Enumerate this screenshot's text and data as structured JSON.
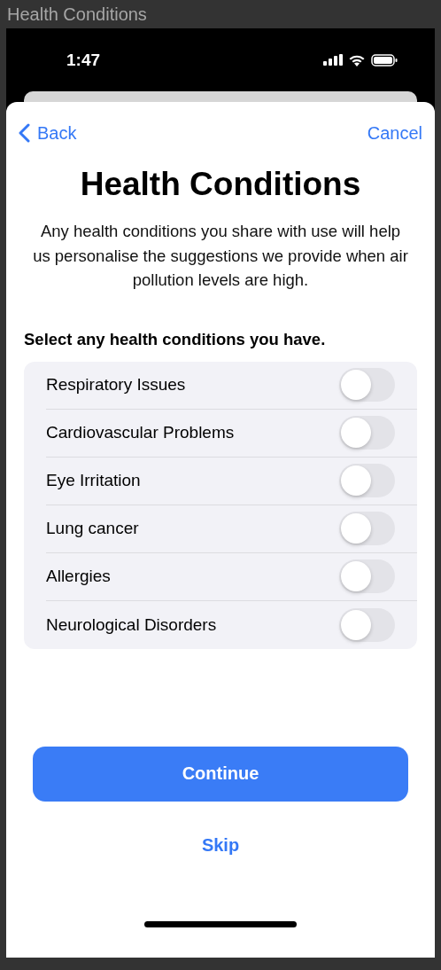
{
  "window": {
    "title": "Health Conditions"
  },
  "status_bar": {
    "time": "1:47"
  },
  "nav": {
    "back": "Back",
    "cancel": "Cancel"
  },
  "title": "Health Conditions",
  "description": "Any health conditions you share with use will help us personalise the suggestions we provide when air pollution levels are high.",
  "section_heading": "Select any health conditions you have.",
  "conditions": [
    {
      "label": "Respiratory Issues",
      "on": false
    },
    {
      "label": "Cardiovascular Problems",
      "on": false
    },
    {
      "label": "Eye Irritation",
      "on": false
    },
    {
      "label": "Lung cancer",
      "on": false
    },
    {
      "label": "Allergies",
      "on": false
    },
    {
      "label": "Neurological Disorders",
      "on": false
    }
  ],
  "buttons": {
    "primary": "Continue",
    "secondary": "Skip"
  }
}
